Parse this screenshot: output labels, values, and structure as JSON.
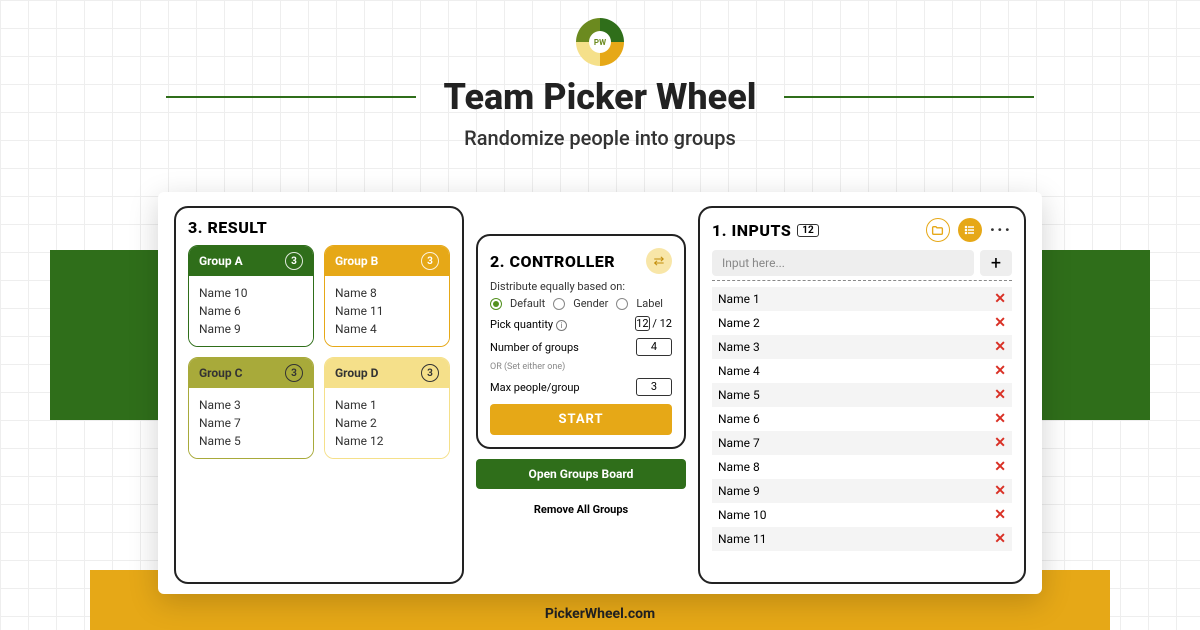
{
  "brand": {
    "badge": "PW",
    "title": "Team Picker Wheel",
    "subtitle": "Randomize people into groups",
    "footer": "PickerWheel.com"
  },
  "result": {
    "heading": "3. RESULT",
    "groups": [
      {
        "name": "Group A",
        "count": "3",
        "members": [
          "Name 10",
          "Name 6",
          "Name 9"
        ]
      },
      {
        "name": "Group B",
        "count": "3",
        "members": [
          "Name 8",
          "Name 11",
          "Name 4"
        ]
      },
      {
        "name": "Group C",
        "count": "3",
        "members": [
          "Name 3",
          "Name 7",
          "Name 5"
        ]
      },
      {
        "name": "Group D",
        "count": "3",
        "members": [
          "Name 1",
          "Name 2",
          "Name 12"
        ]
      }
    ]
  },
  "controller": {
    "heading": "2. CONTROLLER",
    "distribute_label": "Distribute equally based on:",
    "radios": {
      "default": "Default",
      "gender": "Gender",
      "label": "Label"
    },
    "pick_quantity_label": "Pick quantity",
    "pick_quantity_value": "12",
    "pick_quantity_total": "/ 12",
    "num_groups_label": "Number of groups",
    "num_groups_value": "4",
    "or_label": "OR (Set either one)",
    "max_people_label": "Max people/group",
    "max_people_value": "3",
    "start_label": "START",
    "open_board_label": "Open Groups Board",
    "remove_all_label": "Remove All Groups"
  },
  "inputs": {
    "heading": "1. INPUTS",
    "count": "12",
    "placeholder": "Input here...",
    "items": [
      "Name 1",
      "Name 2",
      "Name 3",
      "Name 4",
      "Name 5",
      "Name 6",
      "Name 7",
      "Name 8",
      "Name 9",
      "Name 10",
      "Name 11"
    ]
  }
}
